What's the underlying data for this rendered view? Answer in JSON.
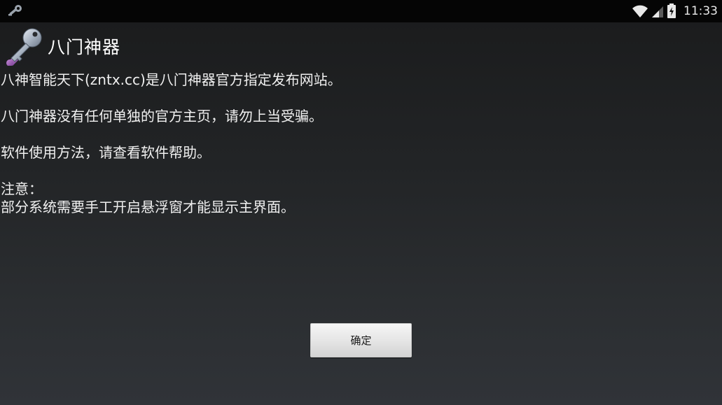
{
  "status_bar": {
    "time": "11:33",
    "icons": [
      "app-key-icon",
      "wifi-icon",
      "signal-icon",
      "battery-charging-icon"
    ]
  },
  "dialog": {
    "title": "八门神器",
    "icon": "key-wrench-icon",
    "lines": {
      "line1": "八神智能天下(zntx.cc)是八门神器官方指定发布网站。",
      "line2": "八门神器没有任何单独的官方主页，请勿上当受骗。",
      "line3": "软件使用方法，请查看软件帮助。",
      "note_label": "注意：",
      "note_text": "部分系统需要手工开启悬浮窗才能显示主界面。"
    },
    "ok_label": "确定"
  },
  "colors": {
    "background_top": "#1a1b1c",
    "background_bottom": "#303338",
    "status_bar": "#050505",
    "text": "#f0f0f0",
    "button_face": "#e4e4e4"
  }
}
